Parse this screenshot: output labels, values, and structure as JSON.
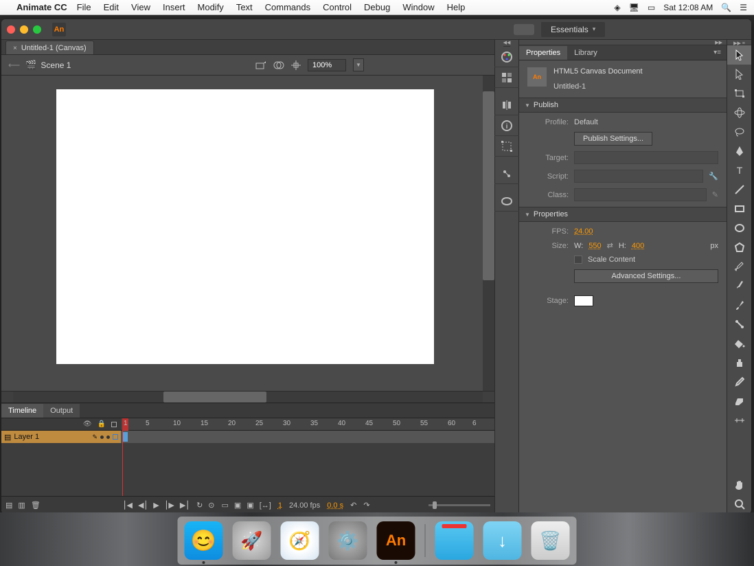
{
  "menubar": {
    "app": "Animate CC",
    "items": [
      "File",
      "Edit",
      "View",
      "Insert",
      "Modify",
      "Text",
      "Commands",
      "Control",
      "Debug",
      "Window",
      "Help"
    ],
    "clock": "Sat 12:08 AM"
  },
  "titlebar": {
    "workspace": "Essentials"
  },
  "document": {
    "tab": "Untitled-1 (Canvas)",
    "scene": "Scene 1",
    "zoom": "100%"
  },
  "timeline": {
    "tabs": [
      "Timeline",
      "Output"
    ],
    "layer": "Layer 1",
    "ruler_marks": [
      "1",
      "5",
      "10",
      "15",
      "20",
      "25",
      "30",
      "35",
      "40",
      "45",
      "50",
      "55",
      "60",
      "6"
    ],
    "footer": {
      "frame": "1",
      "fps": "24.00 fps",
      "time": "0.0 s"
    }
  },
  "properties": {
    "tabs": [
      "Properties",
      "Library"
    ],
    "doc_type": "HTML5 Canvas Document",
    "doc_name": "Untitled-1",
    "publish": {
      "title": "Publish",
      "profile_label": "Profile:",
      "profile_value": "Default",
      "settings_btn": "Publish Settings...",
      "target_label": "Target:",
      "script_label": "Script:",
      "class_label": "Class:"
    },
    "props": {
      "title": "Properties",
      "fps_label": "FPS:",
      "fps_value": "24.00",
      "size_label": "Size:",
      "w_label": "W:",
      "w_value": "550",
      "h_label": "H:",
      "h_value": "400",
      "unit": "px",
      "scale_label": "Scale Content",
      "adv_btn": "Advanced Settings...",
      "stage_label": "Stage:"
    }
  },
  "dock": {
    "apps": [
      "Finder",
      "Launchpad",
      "Safari",
      "System Preferences",
      "Adobe Animate"
    ],
    "right": [
      "Folder",
      "Downloads",
      "Trash"
    ]
  }
}
